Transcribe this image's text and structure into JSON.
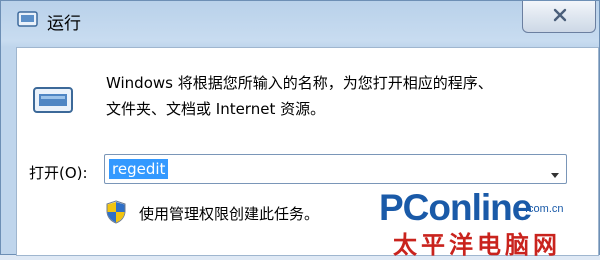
{
  "window": {
    "title": "运行"
  },
  "description": {
    "line1": "Windows 将根据您所输入的名称，为您打开相应的程序、",
    "line2": "文件夹、文档或 Internet 资源。"
  },
  "open_field": {
    "label": "打开(O):",
    "value": "regedit"
  },
  "admin_note": "使用管理权限创建此任务。",
  "watermark": {
    "brand": "PConline",
    "domain": ".com.cn",
    "chinese": "太平洋电脑网"
  },
  "icons": {
    "title": "run-icon",
    "close": "close-icon",
    "dialog": "run-icon",
    "admin": "shield-icon",
    "dropdown": "chevron-down-icon"
  },
  "colors": {
    "selection": "#3399ff",
    "brand_blue": "#1a5aa8",
    "brand_red": "#c9231d"
  }
}
